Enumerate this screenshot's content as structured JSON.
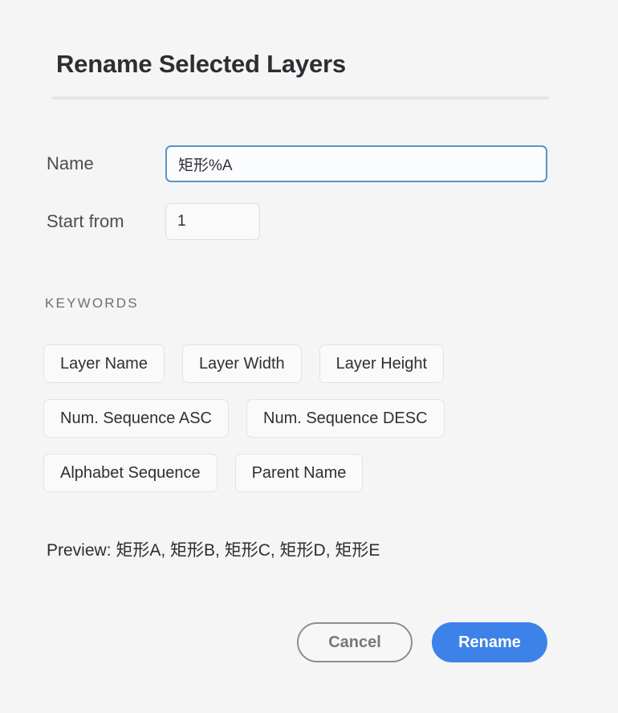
{
  "dialog": {
    "title": "Rename Selected Layers"
  },
  "form": {
    "name": {
      "label": "Name",
      "value": "矩形%A",
      "placeholder": "Name"
    },
    "start_from": {
      "label": "Start from",
      "value": "1",
      "placeholder": "1"
    }
  },
  "keywords": {
    "heading": "KEYWORDS",
    "rows": [
      [
        {
          "label": "Layer Name"
        },
        {
          "label": "Layer Width"
        },
        {
          "label": "Layer Height"
        }
      ],
      [
        {
          "label": "Num. Sequence ASC"
        },
        {
          "label": "Num. Sequence DESC"
        }
      ],
      [
        {
          "label": "Alphabet Sequence"
        },
        {
          "label": "Parent Name"
        }
      ]
    ]
  },
  "preview": {
    "text": "Preview: 矩形A, 矩形B, 矩形C, 矩形D, 矩形E"
  },
  "footer": {
    "cancel_label": "Cancel",
    "rename_label": "Rename"
  },
  "colors": {
    "background": "#f5f5f5",
    "accent": "#3d82e8",
    "focus_border": "#5b93c4",
    "divider": "#e6e6e6",
    "button_border": "#e3e3e3",
    "cancel_border": "#8d8d8d"
  }
}
